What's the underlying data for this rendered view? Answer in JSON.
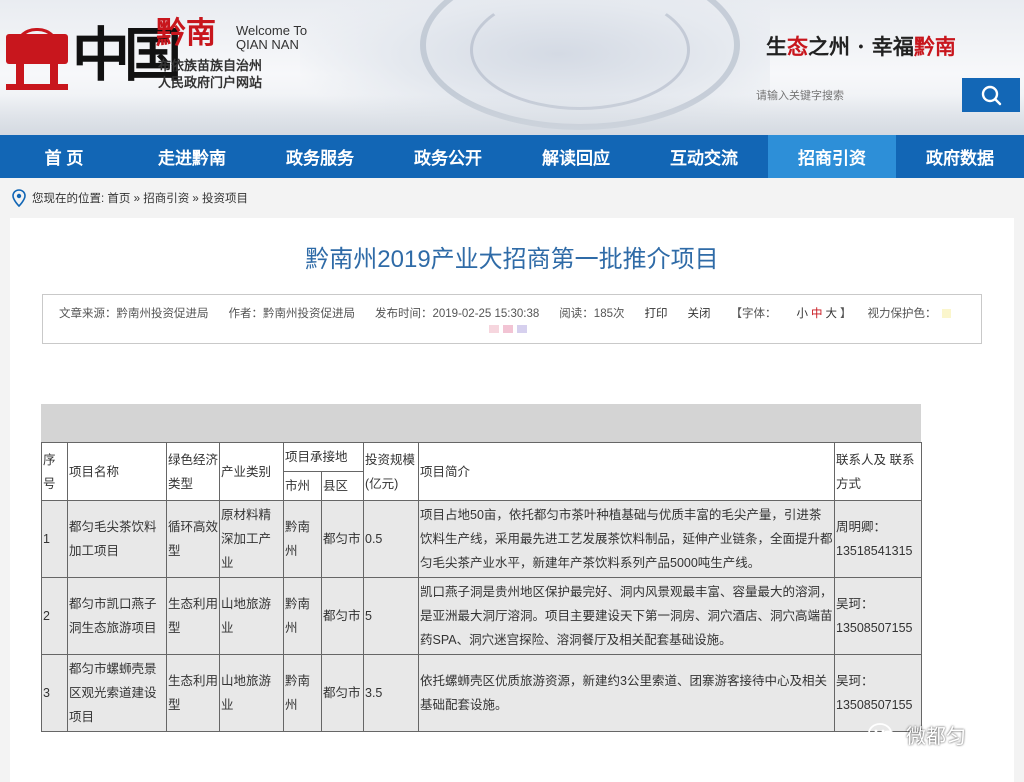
{
  "header": {
    "logo_zhongguo": "中国",
    "logo_qiannan": "黔南",
    "welcome_line1": "Welcome To",
    "welcome_line2": "QIAN NAN",
    "subtitle1": "布依族苗族自治州",
    "subtitle2": "人民政府门户网站",
    "slogan_part1": "生",
    "slogan_part2": "态",
    "slogan_part3": "之州 · 幸福",
    "slogan_part4": "黔南",
    "search_placeholder": "请输入关键字搜索"
  },
  "nav": {
    "items": [
      "首 页",
      "走进黔南",
      "政务服务",
      "政务公开",
      "解读回应",
      "互动交流",
      "招商引资",
      "政府数据"
    ],
    "active_index": 6
  },
  "breadcrumb": {
    "prefix": "您现在的位置:",
    "home": "首页",
    "sep": "»",
    "level1": "招商引资",
    "level2": "投资项目"
  },
  "article": {
    "title": "黔南州2019产业大招商第一批推介项目",
    "source": "文章来源：黔南州投资促进局",
    "author": "作者：黔南州投资促进局",
    "publish_time": "发布时间：2019-02-25 15:30:38",
    "reads": "阅读：185次",
    "print": "打印",
    "close": "关闭",
    "font_label_open": "【字体：",
    "font_small": "小",
    "font_medium": "中",
    "font_large": "大",
    "font_label_close": "】",
    "eye_care": "视力保护色："
  },
  "table": {
    "headers": {
      "seq": "序号",
      "name": "项目名称",
      "green_type": "绿色经济类型",
      "industry": "产业类别",
      "location_group": "项目承接地",
      "city": "市州",
      "county": "县区",
      "investment": "投资规模(亿元)",
      "intro": "项目简介",
      "contact": "联系人及 联系方式"
    },
    "rows": [
      {
        "seq": "1",
        "name": "都匀毛尖茶饮料加工项目",
        "green_type": "循环高效型",
        "industry": "原材料精深加工产业",
        "city": "黔南州",
        "county": "都匀市",
        "investment": "0.5",
        "intro": "项目占地50亩，依托都匀市茶叶种植基础与优质丰富的毛尖产量，引进茶饮料生产线，采用最先进工艺发展茶饮料制品，延伸产业链条，全面提升都匀毛尖茶产业水平，新建年产茶饮料系列产品5000吨生产线。",
        "contact": "周明卿：13518541315"
      },
      {
        "seq": "2",
        "name": "都匀市凯口燕子洞生态旅游项目",
        "green_type": "生态利用型",
        "industry": "山地旅游业",
        "city": "黔南州",
        "county": "都匀市",
        "investment": "5",
        "intro": "凯口燕子洞是贵州地区保护最完好、洞内风景观最丰富、容量最大的溶洞，是亚洲最大洞厅溶洞。项目主要建设天下第一洞房、洞穴酒店、洞穴高端苗药SPA、洞穴迷宫探险、溶洞餐厅及相关配套基础设施。",
        "contact": "吴珂：13508507155"
      },
      {
        "seq": "3",
        "name": "都匀市螺蛳壳景区观光索道建设项目",
        "green_type": "生态利用型",
        "industry": "山地旅游业",
        "city": "黔南州",
        "county": "都匀市",
        "investment": "3.5",
        "intro": "依托螺蛳壳区优质旅游资源，新建约3公里索道、团寨游客接待中心及相关基础配套设施。",
        "contact": "吴珂：13508507155"
      }
    ]
  },
  "watermark": "微都匀",
  "colors": {
    "nav_bg": "#1266b5",
    "nav_active": "#2d8fd8",
    "title": "#2f6ba7",
    "brand_red": "#c8161d"
  }
}
